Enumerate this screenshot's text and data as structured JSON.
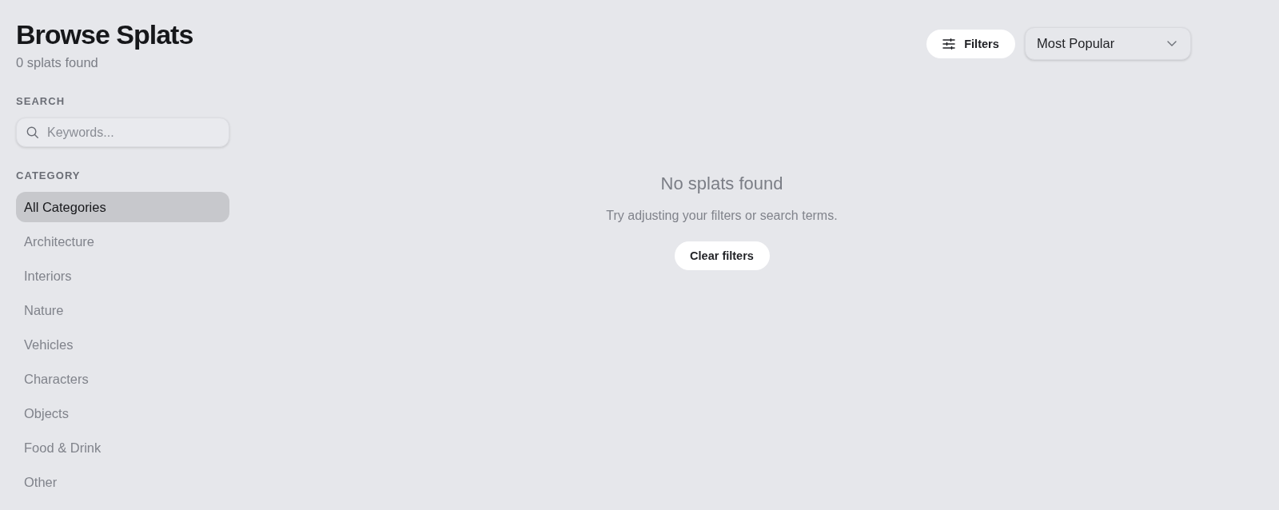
{
  "header": {
    "title": "Browse Splats",
    "count": "0 splats found"
  },
  "sidebar": {
    "search": {
      "label": "SEARCH",
      "placeholder": "Keywords..."
    },
    "category": {
      "label": "CATEGORY",
      "items": [
        {
          "label": "All Categories",
          "selected": true
        },
        {
          "label": "Architecture",
          "selected": false
        },
        {
          "label": "Interiors",
          "selected": false
        },
        {
          "label": "Nature",
          "selected": false
        },
        {
          "label": "Vehicles",
          "selected": false
        },
        {
          "label": "Characters",
          "selected": false
        },
        {
          "label": "Objects",
          "selected": false
        },
        {
          "label": "Food & Drink",
          "selected": false
        },
        {
          "label": "Other",
          "selected": false
        }
      ]
    }
  },
  "toolbar": {
    "filters_button": "Filters",
    "sort": {
      "value": "Most Popular"
    }
  },
  "empty_state": {
    "title": "No splats found",
    "message": "Try adjusting your filters or search terms.",
    "button": "Clear filters"
  }
}
